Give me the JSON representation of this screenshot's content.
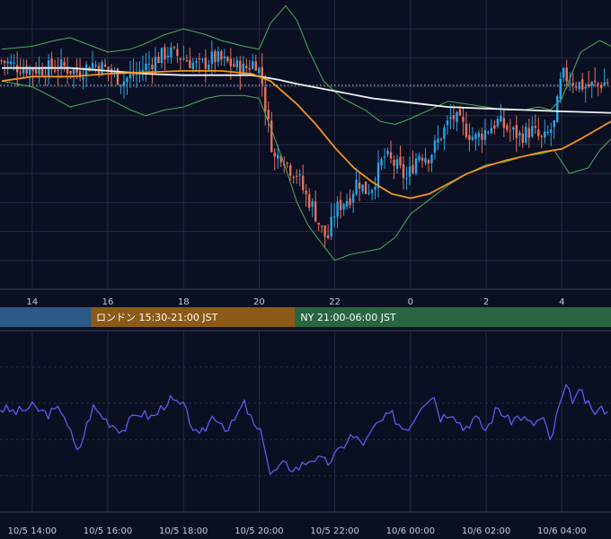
{
  "theme": {
    "background": "#0b0f22",
    "grid": "#262b44",
    "up_candle": "#2aa5e6",
    "down_candle": "#e8705a",
    "bollinger": "#4cae5e",
    "ma_fast": "#f0961c",
    "ma_slow": "#f2f2f2",
    "oscillator": "#5a5cf0",
    "reference_line": "#d8d8d8"
  },
  "chart_data": [
    {
      "type": "candlestick",
      "panel": "price",
      "x_unit": "hour",
      "x_tick_labels": [
        "14",
        "16",
        "18",
        "20",
        "22",
        "0",
        "2",
        "4"
      ],
      "x_tick_hours": [
        14,
        16,
        18,
        20,
        22,
        24,
        26,
        28
      ],
      "xlim": [
        13.15,
        29.3
      ],
      "ylim": [
        0,
        100
      ],
      "grid": true,
      "reference_level": 70.5,
      "close_path": [
        [
          13.2,
          79
        ],
        [
          13.6,
          77
        ],
        [
          14.2,
          76
        ],
        [
          14.8,
          77
        ],
        [
          15.2,
          75
        ],
        [
          15.6,
          78
        ],
        [
          16.0,
          76
        ],
        [
          16.4,
          72
        ],
        [
          16.8,
          75
        ],
        [
          17.2,
          79
        ],
        [
          17.6,
          82
        ],
        [
          18.0,
          80
        ],
        [
          18.4,
          77
        ],
        [
          18.8,
          80
        ],
        [
          19.2,
          78
        ],
        [
          19.6,
          76
        ],
        [
          19.9,
          79
        ],
        [
          20.05,
          74
        ],
        [
          20.2,
          60
        ],
        [
          20.4,
          45
        ],
        [
          20.6,
          47
        ],
        [
          20.8,
          42
        ],
        [
          21.0,
          40
        ],
        [
          21.2,
          33
        ],
        [
          21.4,
          29
        ],
        [
          21.6,
          22
        ],
        [
          21.8,
          17
        ],
        [
          22.0,
          27
        ],
        [
          22.2,
          30
        ],
        [
          22.4,
          32
        ],
        [
          22.6,
          38
        ],
        [
          22.8,
          34
        ],
        [
          23.0,
          36
        ],
        [
          23.3,
          46
        ],
        [
          23.6,
          43
        ],
        [
          23.9,
          38
        ],
        [
          24.2,
          47
        ],
        [
          24.5,
          46
        ],
        [
          24.8,
          53
        ],
        [
          25.1,
          60
        ],
        [
          25.4,
          56
        ],
        [
          25.7,
          52
        ],
        [
          26.0,
          55
        ],
        [
          26.3,
          58
        ],
        [
          26.6,
          55
        ],
        [
          26.9,
          53
        ],
        [
          27.2,
          55
        ],
        [
          27.5,
          51
        ],
        [
          27.8,
          57
        ],
        [
          28.0,
          74
        ],
        [
          28.3,
          72
        ],
        [
          28.6,
          70
        ],
        [
          29.0,
          71
        ],
        [
          29.3,
          72
        ]
      ],
      "series": [
        {
          "name": "",
          "role": "ma_fast",
          "points": [
            [
              13.2,
              72
            ],
            [
              14.0,
              73.5
            ],
            [
              15.0,
              73.5
            ],
            [
              16.0,
              74.5
            ],
            [
              17.0,
              75
            ],
            [
              18.0,
              75.5
            ],
            [
              19.0,
              75.5
            ],
            [
              19.8,
              74.5
            ],
            [
              20.3,
              72
            ],
            [
              21.0,
              64
            ],
            [
              21.5,
              57
            ],
            [
              22.0,
              49
            ],
            [
              22.5,
              42
            ],
            [
              23.0,
              37
            ],
            [
              23.5,
              33
            ],
            [
              24.0,
              31.5
            ],
            [
              24.5,
              33
            ],
            [
              25.0,
              36.5
            ],
            [
              25.5,
              40
            ],
            [
              26.0,
              42.5
            ],
            [
              26.5,
              44.5
            ],
            [
              27.0,
              46
            ],
            [
              27.5,
              47.5
            ],
            [
              28.0,
              48.5
            ],
            [
              28.5,
              52
            ],
            [
              29.3,
              58
            ]
          ]
        },
        {
          "name": "",
          "role": "ma_slow",
          "points": [
            [
              13.2,
              76.5
            ],
            [
              14.0,
              76.5
            ],
            [
              15.0,
              76.5
            ],
            [
              16.0,
              75.5
            ],
            [
              17.0,
              74.5
            ],
            [
              18.0,
              74
            ],
            [
              19.0,
              74
            ],
            [
              19.8,
              74
            ],
            [
              20.5,
              72.5
            ],
            [
              21.0,
              71
            ],
            [
              22.0,
              68.5
            ],
            [
              23.0,
              66
            ],
            [
              24.0,
              64.5
            ],
            [
              25.0,
              63
            ],
            [
              26.0,
              62.5
            ],
            [
              27.0,
              62
            ],
            [
              28.0,
              61.5
            ],
            [
              29.3,
              61
            ]
          ]
        },
        {
          "name": "",
          "role": "bollinger_upper",
          "points": [
            [
              13.2,
              83
            ],
            [
              14.0,
              84
            ],
            [
              14.6,
              86
            ],
            [
              15.0,
              87
            ],
            [
              15.6,
              84
            ],
            [
              16.0,
              82
            ],
            [
              16.6,
              83
            ],
            [
              17.0,
              85
            ],
            [
              17.5,
              88
            ],
            [
              18.0,
              90
            ],
            [
              18.6,
              88
            ],
            [
              19.0,
              86
            ],
            [
              19.6,
              84
            ],
            [
              20.0,
              83
            ],
            [
              20.3,
              92
            ],
            [
              20.7,
              98
            ],
            [
              21.0,
              93
            ],
            [
              21.3,
              83
            ],
            [
              21.7,
              72
            ],
            [
              22.2,
              66
            ],
            [
              22.8,
              62
            ],
            [
              23.2,
              58
            ],
            [
              23.6,
              57
            ],
            [
              24.0,
              59
            ],
            [
              24.5,
              62
            ],
            [
              25.0,
              65
            ],
            [
              25.5,
              64
            ],
            [
              26.0,
              63
            ],
            [
              26.5,
              62
            ],
            [
              27.0,
              62
            ],
            [
              27.4,
              63
            ],
            [
              27.7,
              62
            ],
            [
              28.0,
              66
            ],
            [
              28.5,
              82
            ],
            [
              29.0,
              86
            ],
            [
              29.3,
              84
            ]
          ]
        },
        {
          "name": "",
          "role": "bollinger_lower",
          "points": [
            [
              13.2,
              72
            ],
            [
              14.0,
              70
            ],
            [
              14.6,
              66
            ],
            [
              15.0,
              63
            ],
            [
              15.6,
              65
            ],
            [
              16.0,
              66
            ],
            [
              16.6,
              62
            ],
            [
              17.0,
              60
            ],
            [
              17.5,
              62
            ],
            [
              18.0,
              63
            ],
            [
              18.6,
              66
            ],
            [
              19.0,
              67
            ],
            [
              19.6,
              67
            ],
            [
              20.0,
              66
            ],
            [
              20.3,
              56
            ],
            [
              20.7,
              42
            ],
            [
              21.0,
              30
            ],
            [
              21.3,
              22
            ],
            [
              21.7,
              15
            ],
            [
              22.0,
              10
            ],
            [
              22.4,
              12
            ],
            [
              22.8,
              13
            ],
            [
              23.2,
              14
            ],
            [
              23.6,
              18
            ],
            [
              24.0,
              26
            ],
            [
              24.5,
              31
            ],
            [
              25.0,
              36
            ],
            [
              25.5,
              40
            ],
            [
              26.0,
              43
            ],
            [
              26.5,
              44
            ],
            [
              27.0,
              46
            ],
            [
              27.5,
              47
            ],
            [
              27.8,
              48
            ],
            [
              28.2,
              40
            ],
            [
              28.7,
              42
            ],
            [
              29.0,
              48
            ],
            [
              29.3,
              52
            ]
          ]
        }
      ],
      "sessions": [
        {
          "label": "",
          "color": "#2b5a88",
          "start_hour": 13.15,
          "end_hour": 15.55
        },
        {
          "label": "ロンドン 15:30-21:00 JST",
          "color": "#8b5a16",
          "start_hour": 15.55,
          "end_hour": 20.95
        },
        {
          "label": "NY 21:00-06:00 JST",
          "color": "#276640",
          "start_hour": 20.95,
          "end_hour": 29.3
        }
      ]
    },
    {
      "type": "line",
      "panel": "oscillator",
      "x_tick_labels": [
        "10/5 14:00",
        "10/5 16:00",
        "10/5 18:00",
        "10/5 20:00",
        "10/5 22:00",
        "10/6 00:00",
        "10/6 02:00",
        "10/6 04:00"
      ],
      "x_tick_hours": [
        14,
        16,
        18,
        20,
        22,
        24,
        26,
        28
      ],
      "ylim": [
        0,
        100
      ],
      "grid": true,
      "series": [
        {
          "name": "",
          "points": [
            [
              13.2,
              57
            ],
            [
              13.6,
              55
            ],
            [
              14.0,
              58
            ],
            [
              14.4,
              54
            ],
            [
              14.8,
              57
            ],
            [
              15.2,
              32
            ],
            [
              15.6,
              58
            ],
            [
              16.0,
              50
            ],
            [
              16.4,
              45
            ],
            [
              16.8,
              55
            ],
            [
              17.2,
              52
            ],
            [
              17.6,
              62
            ],
            [
              18.0,
              58
            ],
            [
              18.4,
              40
            ],
            [
              18.8,
              54
            ],
            [
              19.2,
              45
            ],
            [
              19.6,
              60
            ],
            [
              19.9,
              46
            ],
            [
              20.1,
              42
            ],
            [
              20.3,
              20
            ],
            [
              20.6,
              26
            ],
            [
              21.0,
              24
            ],
            [
              21.4,
              30
            ],
            [
              21.8,
              27
            ],
            [
              22.1,
              33
            ],
            [
              22.4,
              42
            ],
            [
              22.8,
              38
            ],
            [
              23.1,
              48
            ],
            [
              23.5,
              54
            ],
            [
              23.8,
              46
            ],
            [
              24.0,
              48
            ],
            [
              24.3,
              60
            ],
            [
              24.6,
              65
            ],
            [
              24.8,
              52
            ],
            [
              25.1,
              56
            ],
            [
              25.4,
              46
            ],
            [
              25.7,
              52
            ],
            [
              26.0,
              45
            ],
            [
              26.3,
              58
            ],
            [
              26.6,
              50
            ],
            [
              26.9,
              53
            ],
            [
              27.2,
              48
            ],
            [
              27.5,
              52
            ],
            [
              27.7,
              38
            ],
            [
              27.9,
              56
            ],
            [
              28.1,
              68
            ],
            [
              28.3,
              62
            ],
            [
              28.5,
              66
            ],
            [
              28.8,
              55
            ],
            [
              29.0,
              56
            ],
            [
              29.3,
              58
            ]
          ]
        }
      ]
    }
  ]
}
